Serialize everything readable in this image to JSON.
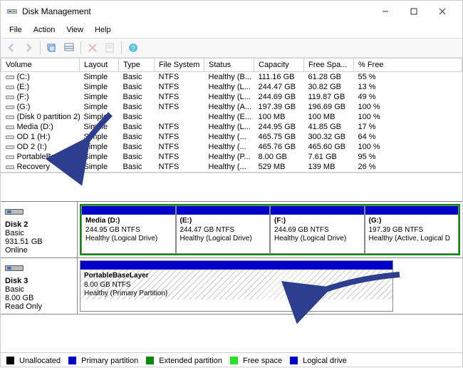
{
  "window": {
    "title": "Disk Management"
  },
  "menu": {
    "items": [
      "File",
      "Action",
      "View",
      "Help"
    ]
  },
  "columns": [
    "Volume",
    "Layout",
    "Type",
    "File System",
    "Status",
    "Capacity",
    "Free Spa...",
    "% Free"
  ],
  "volumes": [
    {
      "name": "(C:)",
      "layout": "Simple",
      "type": "Basic",
      "fs": "NTFS",
      "status": "Healthy (B...",
      "capacity": "111.16 GB",
      "free": "61.28 GB",
      "pct": "55 %"
    },
    {
      "name": "(E:)",
      "layout": "Simple",
      "type": "Basic",
      "fs": "NTFS",
      "status": "Healthy (L...",
      "capacity": "244.47 GB",
      "free": "30.82 GB",
      "pct": "13 %"
    },
    {
      "name": "(F:)",
      "layout": "Simple",
      "type": "Basic",
      "fs": "NTFS",
      "status": "Healthy (L...",
      "capacity": "244.69 GB",
      "free": "119.87 GB",
      "pct": "49 %"
    },
    {
      "name": "(G:)",
      "layout": "Simple",
      "type": "Basic",
      "fs": "NTFS",
      "status": "Healthy (A...",
      "capacity": "197.39 GB",
      "free": "196.69 GB",
      "pct": "100 %"
    },
    {
      "name": "(Disk 0 partition 2)",
      "layout": "Simple",
      "type": "Basic",
      "fs": "",
      "status": "Healthy (E...",
      "capacity": "100 MB",
      "free": "100 MB",
      "pct": "100 %"
    },
    {
      "name": "Media (D:)",
      "layout": "Simple",
      "type": "Basic",
      "fs": "NTFS",
      "status": "Healthy (L...",
      "capacity": "244.95 GB",
      "free": "41.85 GB",
      "pct": "17 %"
    },
    {
      "name": "OD 1 (H:)",
      "layout": "Simple",
      "type": "Basic",
      "fs": "NTFS",
      "status": "Healthy (...",
      "capacity": "465.75 GB",
      "free": "300.32 GB",
      "pct": "64 %"
    },
    {
      "name": "OD 2 (I:)",
      "layout": "Simple",
      "type": "Basic",
      "fs": "NTFS",
      "status": "Healthy (...",
      "capacity": "465.76 GB",
      "free": "465.60 GB",
      "pct": "100 %"
    },
    {
      "name": "PortableBaseLayer",
      "layout": "Simple",
      "type": "Basic",
      "fs": "NTFS",
      "status": "Healthy (P...",
      "capacity": "8.00 GB",
      "free": "7.61 GB",
      "pct": "95 %"
    },
    {
      "name": "Recovery",
      "layout": "Simple",
      "type": "Basic",
      "fs": "NTFS",
      "status": "Healthy (...",
      "capacity": "529 MB",
      "free": "139 MB",
      "pct": "26 %"
    }
  ],
  "disk2": {
    "title": "Disk 2",
    "type": "Basic",
    "size": "931.51 GB",
    "status": "Online",
    "parts": [
      {
        "name": "Media  (D:)",
        "size": "244.95 GB NTFS",
        "status": "Healthy (Logical Drive)"
      },
      {
        "name": "(E:)",
        "size": "244.47 GB NTFS",
        "status": "Healthy (Logical Drive)"
      },
      {
        "name": "(F:)",
        "size": "244.69 GB NTFS",
        "status": "Healthy (Logical Drive)"
      },
      {
        "name": "(G:)",
        "size": "197.39 GB NTFS",
        "status": "Healthy (Active, Logical D"
      }
    ]
  },
  "disk3": {
    "title": "Disk 3",
    "type": "Basic",
    "size": "8.00 GB",
    "status": "Read Only",
    "part": {
      "name": "PortableBaseLayer",
      "size": "8.00 GB NTFS",
      "status": "Healthy (Primary Partition)"
    }
  },
  "legend": {
    "unallocated": "Unallocated",
    "primary": "Primary partition",
    "extended": "Extended partition",
    "free": "Free space",
    "logical": "Logical drive"
  }
}
